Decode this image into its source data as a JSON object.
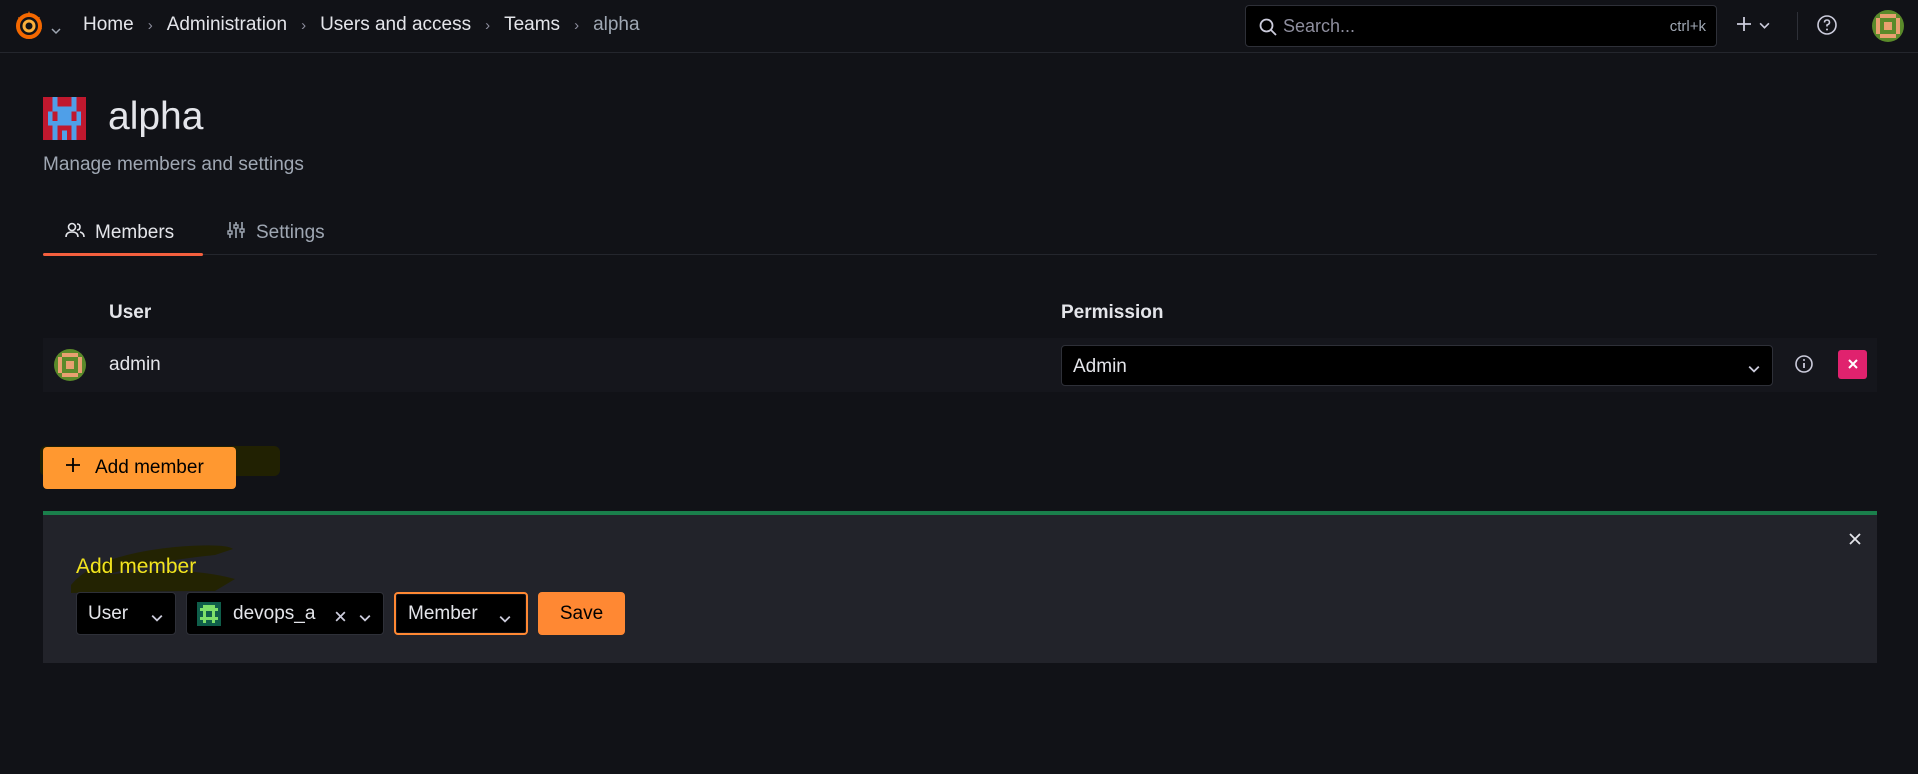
{
  "topbar": {
    "logo_icon": "grafana-logo-icon",
    "breadcrumb": [
      "Home",
      "Administration",
      "Users and access",
      "Teams",
      "alpha"
    ],
    "search": {
      "placeholder": "Search...",
      "shortcut": "ctrl+k"
    },
    "icons": [
      "search-icon",
      "plus-icon",
      "chevron-down-icon",
      "help-icon",
      "user-avatar"
    ]
  },
  "page": {
    "title": "alpha",
    "subtitle": "Manage members and settings"
  },
  "tabs": [
    {
      "label": "Members",
      "icon": "users-icon",
      "active": true
    },
    {
      "label": "Settings",
      "icon": "sliders-icon",
      "active": false
    }
  ],
  "members_table": {
    "headers": {
      "user": "User",
      "permission": "Permission"
    },
    "rows": [
      {
        "user": "admin",
        "permission": "Admin"
      }
    ]
  },
  "add_member_button": {
    "label": "Add member"
  },
  "add_member_panel": {
    "title": "Add member",
    "type_select": "User",
    "user_select": "devops_a",
    "role_select": "Member",
    "save_label": "Save"
  },
  "colors": {
    "background": "#111217",
    "primary_orange": "#ff9830",
    "save_orange": "#ff8833",
    "tab_underline": "#f55f3e",
    "remove_red": "#e0226e",
    "panel_border_green": "#1a7f4b",
    "panel_title_yellow": "#f2e41e"
  }
}
